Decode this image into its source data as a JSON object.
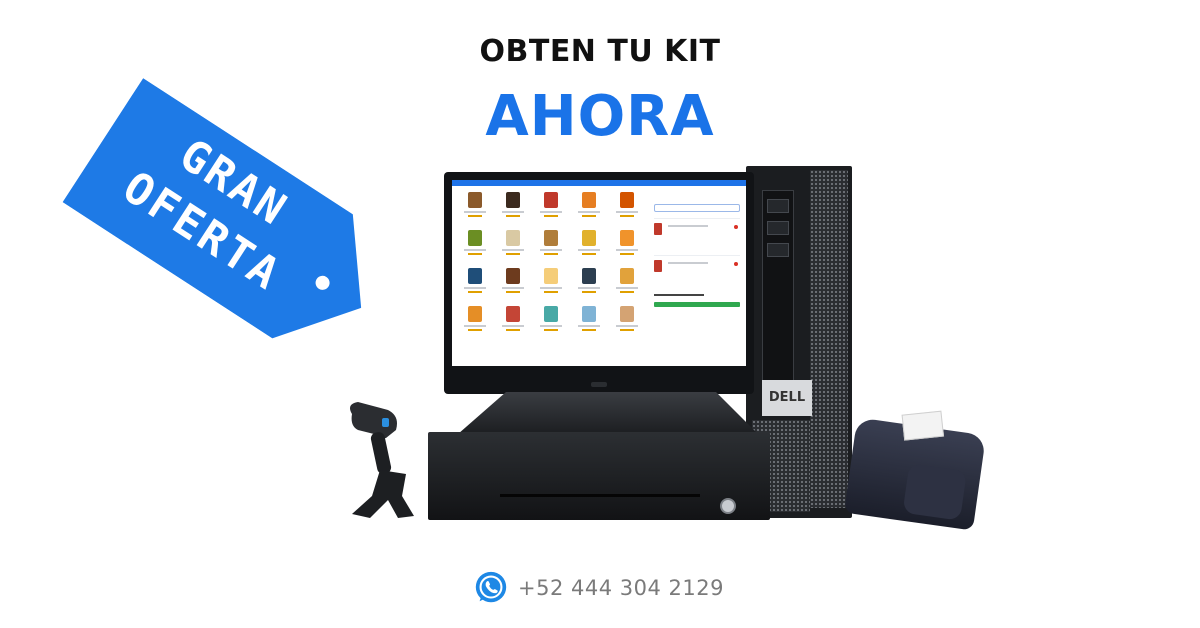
{
  "headline": {
    "line1": "OBTEN TU KIT",
    "line2": "AHORA"
  },
  "tag": {
    "line1": "GRAN",
    "line2": "OFERTA"
  },
  "tower": {
    "brand": "DELL"
  },
  "contact": {
    "icon": "whatsapp-icon",
    "phone": "+52 444 304 2129"
  },
  "colors": {
    "accent": "#1a73e8",
    "text_dark": "#111111",
    "phone_gray": "#7a7a7a",
    "whatsapp_blue": "#1e88e5"
  }
}
